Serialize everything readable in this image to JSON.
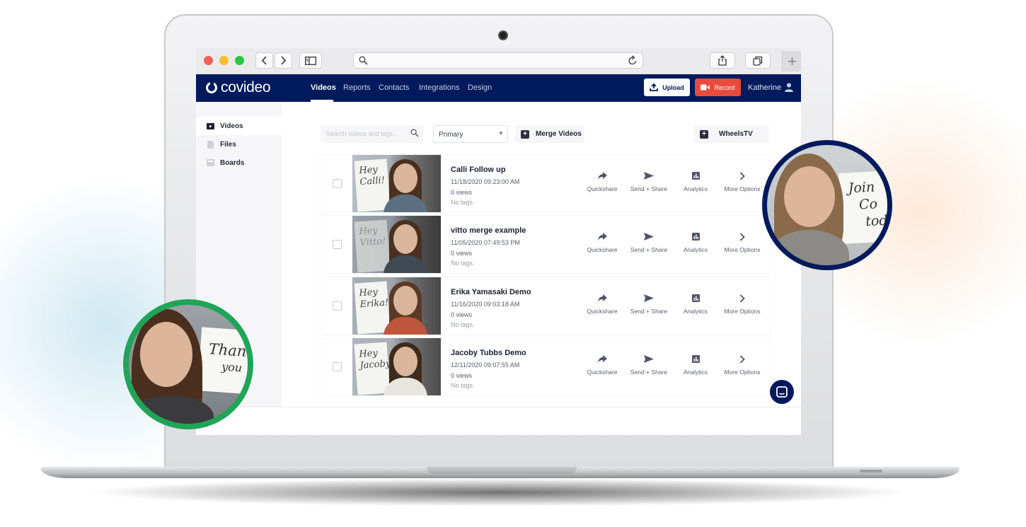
{
  "app": {
    "name": "covideo"
  },
  "nav": {
    "links": [
      "Videos",
      "Reports",
      "Contacts",
      "Integrations",
      "Design"
    ],
    "upload_label": "Upload",
    "record_label": "Record",
    "user_name": "Katherine"
  },
  "sidebar": {
    "items": [
      "Videos",
      "Files",
      "Boards"
    ]
  },
  "toolbar": {
    "search_placeholder": "Search videos and tags...",
    "filter_value": "Primary",
    "merge_label": "Merge Videos",
    "folder_label": "WheelsTV"
  },
  "videos": [
    {
      "title": "Calli Follow up",
      "date": "11/18/2020 09:23:00 AM",
      "views": "0 views",
      "tags": "No tags.",
      "board_text": [
        "Hey",
        "Calli!"
      ]
    },
    {
      "title": "vitto merge example",
      "date": "11/05/2020 07:49:53 PM",
      "views": "0 views",
      "tags": "No tags.",
      "board_text": [
        "Hey",
        "Vitto!"
      ]
    },
    {
      "title": "Erika Yamasaki Demo",
      "date": "11/16/2020 09:03:18 AM",
      "views": "0 views",
      "tags": "No tags.",
      "board_text": [
        "Hey",
        "Erika!"
      ]
    },
    {
      "title": "Jacoby Tubbs Demo",
      "date": "12/11/2020 09:07:55 AM",
      "views": "0 views",
      "tags": "No tags.",
      "board_text": [
        "Hey",
        "Jacoby!"
      ]
    }
  ],
  "row_actions": [
    "Quickshare",
    "Send + Share",
    "Analytics",
    "More Options"
  ],
  "bubbles": {
    "right_board": [
      "Join",
      "Co",
      "tod"
    ],
    "left_board": [
      "Than",
      "you"
    ]
  },
  "colors": {
    "navy": "#001a5c",
    "record_red": "#e84b3c",
    "green_ring": "#20a458"
  }
}
